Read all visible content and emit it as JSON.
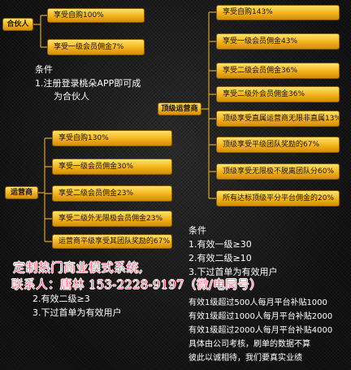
{
  "partner": {
    "tag": "合伙人",
    "items": [
      "享受自购100%",
      "享受一级会员佣金7%"
    ],
    "conditions_title": "条件",
    "conditions": [
      "1.注册登录桃朵APP即可成",
      "为合伙人"
    ]
  },
  "top_operator": {
    "tag": "顶级运营商",
    "items": [
      "享受自购143%",
      "享受一级会员佣金43%",
      "享受二级会员佣金36%",
      "享受二级外会员佣金36%",
      "顶级享受直属运营商无限非直属13%",
      "顶级享受平级团队奖励的67%",
      "顶级享受无限极不脱离团队分60%",
      "所有达标顶级平分平台佣金的20%"
    ]
  },
  "operator": {
    "tag": "运营商",
    "items": [
      "享受自购130%",
      "享受一级会员佣金30%",
      "享受二级会员佣金23%",
      "享受二级外无限极会员佣金23%",
      "运营商平级享受其团队奖励的67%"
    ],
    "conditions": [
      "2.有效二级≥3",
      "3.下过首单为有效用户"
    ]
  },
  "top_conditions": {
    "title": "条件",
    "lines": [
      "1.有效一级≥30",
      "2.有效二级≥10",
      "3.下过首单为有效用户"
    ]
  },
  "subsidy_notes": [
    "有效1级超过500人每月平台补贴1000",
    "有效1级超过1000人每月平台补贴2000",
    "有效1级超过2000人每月平台补贴4000",
    "具体由公司考核，刷单的数据不算",
    "彼此以诚相待，我们要真实业绩"
  ],
  "promo": {
    "line1": "定制热门商业模式系统,",
    "line2": "联系人：唐林 153-2228-9197（微/电同号）"
  }
}
